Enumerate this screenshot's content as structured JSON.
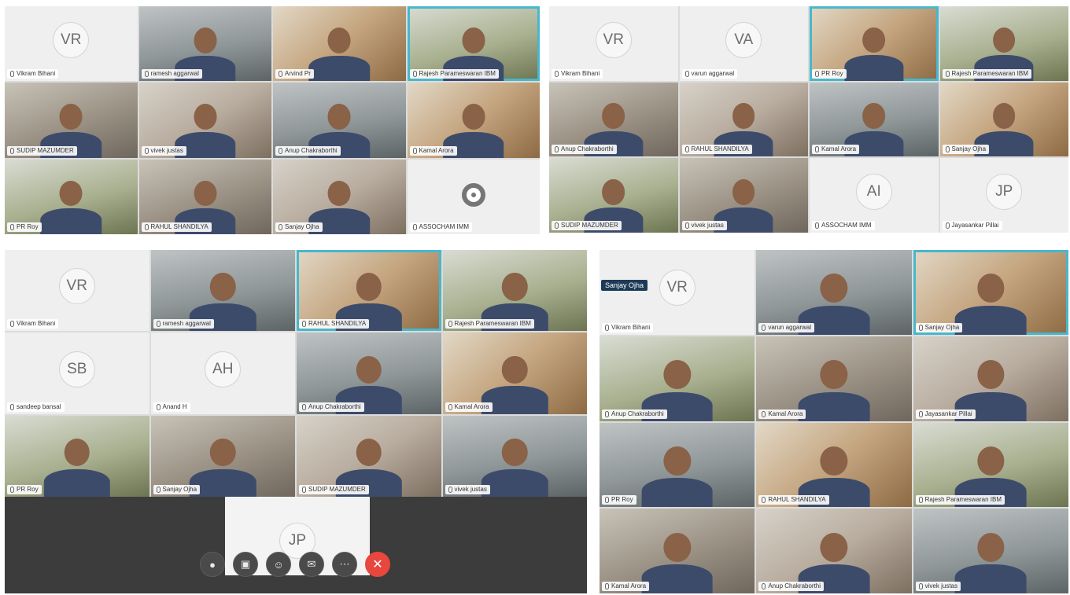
{
  "screens": [
    {
      "tiles": [
        {
          "type": "avatar",
          "initials": "VR",
          "name": "Vikram Bihani",
          "active": false
        },
        {
          "type": "video",
          "name": "ramesh aggarwal",
          "active": false
        },
        {
          "type": "video",
          "name": "Arvind Pr",
          "active": false
        },
        {
          "type": "video",
          "name": "Rajesh Parameswaran IBM",
          "active": true
        },
        {
          "type": "video",
          "name": "SUDIP MAZUMDER",
          "active": false
        },
        {
          "type": "video",
          "name": "vivek justas",
          "active": false
        },
        {
          "type": "video",
          "name": "Anup Chakraborthi",
          "active": false
        },
        {
          "type": "video",
          "name": "Kamal Arora",
          "active": false
        },
        {
          "type": "video",
          "name": "PR Roy",
          "active": false
        },
        {
          "type": "video",
          "name": "RAHUL SHANDILYA",
          "active": false
        },
        {
          "type": "video",
          "name": "Sanjay Ojha",
          "active": false
        },
        {
          "type": "loading",
          "name": "ASSOCHAM IMM",
          "active": false
        }
      ]
    },
    {
      "tiles": [
        {
          "type": "avatar",
          "initials": "VR",
          "name": "Vikram Bihani",
          "active": false
        },
        {
          "type": "avatar",
          "initials": "VA",
          "name": "varun aggarwal",
          "active": false
        },
        {
          "type": "video",
          "name": "PR Roy",
          "active": true
        },
        {
          "type": "video",
          "name": "Rajesh Parameswaran IBM",
          "active": false
        },
        {
          "type": "video",
          "name": "Anup Chakraborthi",
          "active": false
        },
        {
          "type": "video",
          "name": "RAHUL SHANDILYA",
          "active": false
        },
        {
          "type": "video",
          "name": "Kamal Arora",
          "active": false
        },
        {
          "type": "video",
          "name": "Sanjay Ojha",
          "active": false
        },
        {
          "type": "video",
          "name": "SUDIP MAZUMDER",
          "active": false
        },
        {
          "type": "video",
          "name": "vivek justas",
          "active": false
        },
        {
          "type": "avatar",
          "initials": "AI",
          "name": "ASSOCHAM IMM",
          "active": false
        },
        {
          "type": "avatar",
          "initials": "JP",
          "name": "Jayasankar Pillai",
          "active": false
        }
      ]
    },
    {
      "tiles": [
        {
          "type": "avatar",
          "initials": "VR",
          "name": "Vikram Bihani",
          "active": false
        },
        {
          "type": "video",
          "name": "ramesh aggarwal",
          "active": false
        },
        {
          "type": "video",
          "name": "RAHUL SHANDILYA",
          "active": true
        },
        {
          "type": "video",
          "name": "Rajesh Parameswaran IBM",
          "active": false
        },
        {
          "type": "avatar",
          "initials": "SB",
          "name": "sandeep bansal",
          "active": false
        },
        {
          "type": "avatar",
          "initials": "AH",
          "name": "Anand H",
          "active": false
        },
        {
          "type": "video",
          "name": "Anup Chakraborthi",
          "active": false
        },
        {
          "type": "video",
          "name": "Kamal Arora",
          "active": false
        },
        {
          "type": "video",
          "name": "PR Roy",
          "active": false
        },
        {
          "type": "video",
          "name": "Sanjay Ojha",
          "active": false
        },
        {
          "type": "video",
          "name": "SUDIP MAZUMDER",
          "active": false
        },
        {
          "type": "video",
          "name": "vivek justas",
          "active": false
        }
      ],
      "floating_initials": "JP",
      "controls": {
        "mic_icon": "microphone-icon",
        "camera_icon": "camera-icon",
        "participants_icon": "participants-icon",
        "chat_icon": "chat-icon",
        "more_icon": "more-icon",
        "end_icon": "end-call-icon",
        "end_color": "#e8473d"
      }
    },
    {
      "spotlight_label": "Sanjay Ojha",
      "tiles": [
        {
          "type": "avatar",
          "initials": "VR",
          "name": "Vikram Bihani",
          "active": false
        },
        {
          "type": "video",
          "name": "varun aggarwal",
          "active": false
        },
        {
          "type": "video",
          "name": "Sanjay Ojha",
          "active": true
        },
        {
          "type": "video",
          "name": "Anup Chakraborthi",
          "active": false
        },
        {
          "type": "video",
          "name": "Kamal Arora",
          "active": false
        },
        {
          "type": "video",
          "name": "Jayasankar Pillai",
          "active": false
        },
        {
          "type": "video",
          "name": "PR Roy",
          "active": false
        },
        {
          "type": "video",
          "name": "RAHUL SHANDILYA",
          "active": false
        },
        {
          "type": "video",
          "name": "Rajesh Parameswaran IBM",
          "active": false
        },
        {
          "type": "video",
          "name": "Kamal Arora",
          "active": false
        },
        {
          "type": "video",
          "name": "Anup Chakraborthi",
          "active": false
        },
        {
          "type": "video",
          "name": "vivek justas",
          "active": false
        }
      ]
    }
  ],
  "colors": {
    "active_border": "#47b7cc",
    "bar": "#3c3c3c",
    "end_call": "#e8473d"
  }
}
